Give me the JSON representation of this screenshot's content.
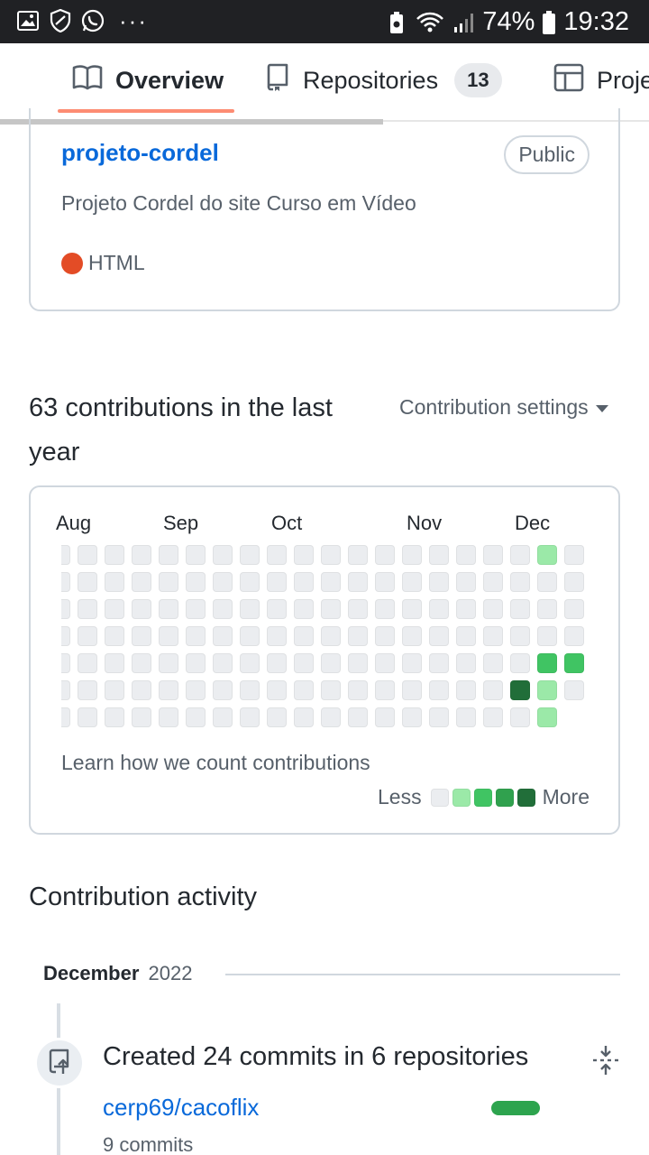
{
  "status_bar": {
    "left_icons": [
      "image-icon",
      "shield-icon",
      "whatsapp-icon"
    ],
    "more": "···",
    "battery_percent": "74%",
    "time": "19:32"
  },
  "tabs": [
    {
      "label": "Overview",
      "icon": "book-icon",
      "selected": true
    },
    {
      "label": "Repositories",
      "icon": "repo-icon",
      "count": "13"
    },
    {
      "label": "Proje",
      "icon": "table-icon"
    }
  ],
  "repo_card": {
    "name": "projeto-cordel",
    "visibility": "Public",
    "description": "Projeto Cordel do site Curso em Vídeo",
    "language": "HTML",
    "language_color": "#e34c26"
  },
  "contributions": {
    "title": "63 contributions in the last year",
    "settings_label": "Contribution settings",
    "months": [
      "Aug",
      "Sep",
      "Oct",
      "Nov",
      "Dec"
    ],
    "learn_link": "Learn how we count contributions",
    "legend_less": "Less",
    "legend_more": "More",
    "level_colors": [
      "#ebedf0",
      "#9be9a8",
      "#40c463",
      "#30a14e",
      "#216e39"
    ],
    "cells": [
      {
        "week": 18,
        "day": 0,
        "level": 1
      },
      {
        "week": 18,
        "day": 4,
        "level": 2
      },
      {
        "week": 19,
        "day": 4,
        "level": 2
      },
      {
        "week": 17,
        "day": 5,
        "level": 4
      },
      {
        "week": 18,
        "day": 5,
        "level": 1
      },
      {
        "week": 18,
        "day": 6,
        "level": 1
      }
    ]
  },
  "activity": {
    "title": "Contribution activity",
    "month": "December",
    "year": "2022",
    "created_text": "Created 24 commits in 6 repositories",
    "repo": "cerp69/cacoflix",
    "commits": "9 commits"
  }
}
